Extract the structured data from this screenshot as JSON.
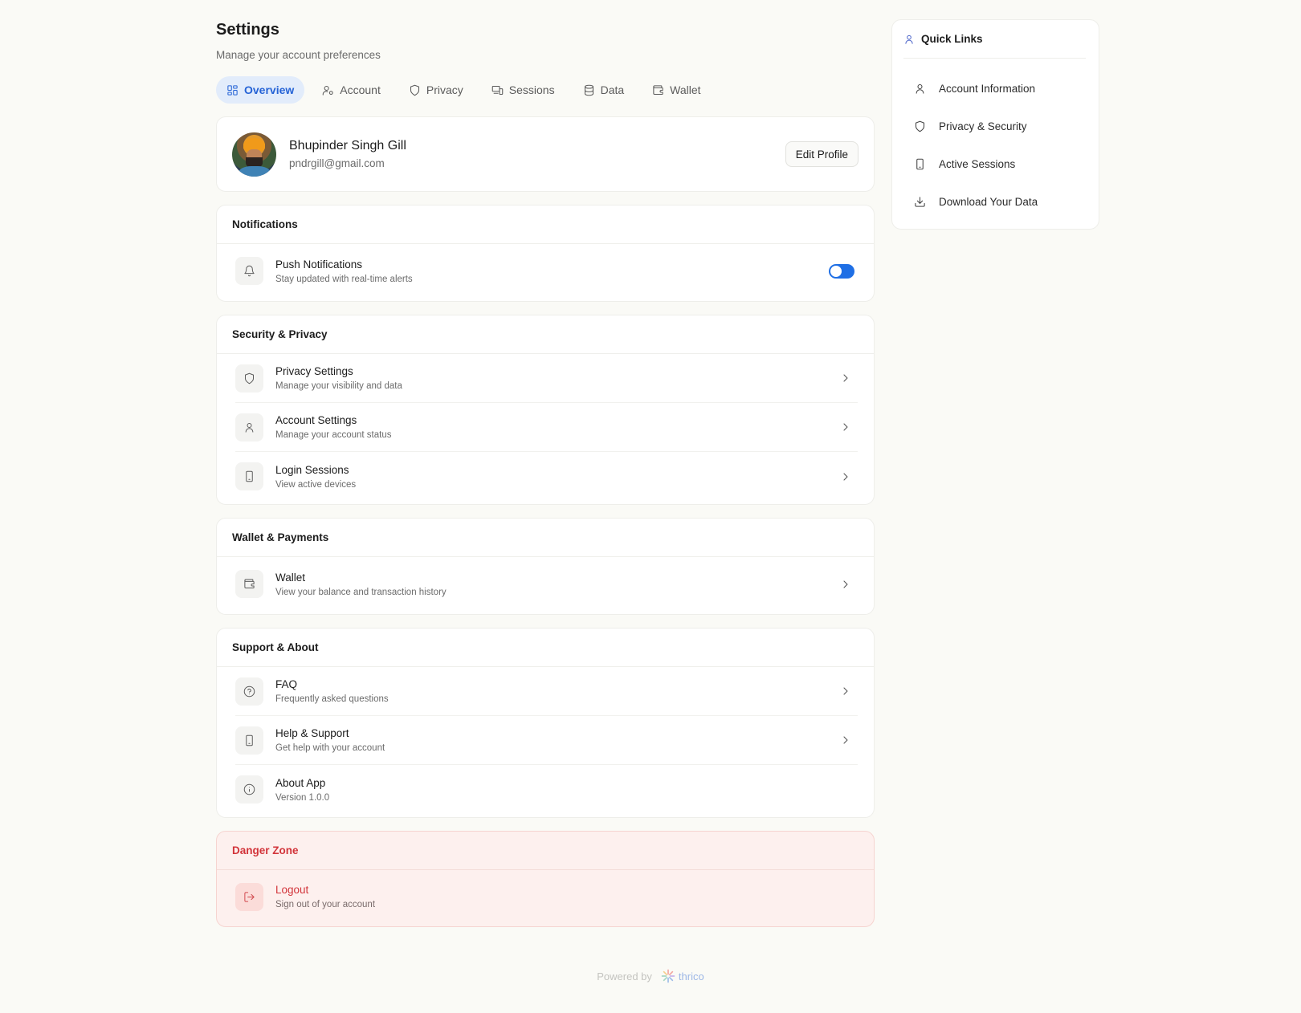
{
  "page": {
    "title": "Settings",
    "subtitle": "Manage your account preferences"
  },
  "tabs": [
    {
      "label": "Overview",
      "icon": "grid-icon",
      "active": true
    },
    {
      "label": "Account",
      "icon": "user-cog-icon",
      "active": false
    },
    {
      "label": "Privacy",
      "icon": "shield-icon",
      "active": false
    },
    {
      "label": "Sessions",
      "icon": "devices-icon",
      "active": false
    },
    {
      "label": "Data",
      "icon": "database-icon",
      "active": false
    },
    {
      "label": "Wallet",
      "icon": "wallet-icon",
      "active": false
    }
  ],
  "profile": {
    "name": "Bhupinder Singh Gill",
    "email": "pndrgill@gmail.com",
    "edit_label": "Edit Profile"
  },
  "notifications": {
    "header": "Notifications",
    "push": {
      "title": "Push Notifications",
      "desc": "Stay updated with real-time alerts",
      "enabled": true,
      "icon": "bell-icon"
    }
  },
  "security": {
    "header": "Security & Privacy",
    "items": [
      {
        "title": "Privacy Settings",
        "desc": "Manage your visibility and data",
        "icon": "shield-icon"
      },
      {
        "title": "Account Settings",
        "desc": "Manage your account status",
        "icon": "user-icon"
      },
      {
        "title": "Login Sessions",
        "desc": "View active devices",
        "icon": "phone-icon"
      }
    ]
  },
  "wallet": {
    "header": "Wallet & Payments",
    "items": [
      {
        "title": "Wallet",
        "desc": "View your balance and transaction history",
        "icon": "wallet-icon"
      }
    ]
  },
  "support": {
    "header": "Support & About",
    "items": [
      {
        "title": "FAQ",
        "desc": "Frequently asked questions",
        "icon": "help-circle-icon"
      },
      {
        "title": "Help & Support",
        "desc": "Get help with your account",
        "icon": "phone-icon"
      },
      {
        "title": "About App",
        "desc": "Version 1.0.0",
        "icon": "info-icon"
      }
    ]
  },
  "danger": {
    "header": "Danger Zone",
    "logout": {
      "title": "Logout",
      "desc": "Sign out of your account",
      "icon": "logout-icon"
    }
  },
  "quick_links": {
    "header": "Quick Links",
    "items": [
      {
        "label": "Account Information",
        "icon": "user-icon"
      },
      {
        "label": "Privacy & Security",
        "icon": "shield-icon"
      },
      {
        "label": "Active Sessions",
        "icon": "phone-icon"
      },
      {
        "label": "Download Your Data",
        "icon": "download-icon"
      }
    ]
  },
  "footer": {
    "powered_by": "Powered by",
    "brand": "thrico"
  },
  "colors": {
    "accent": "#1f6fe5",
    "danger": "#d2343a",
    "background": "#fafaf6"
  }
}
